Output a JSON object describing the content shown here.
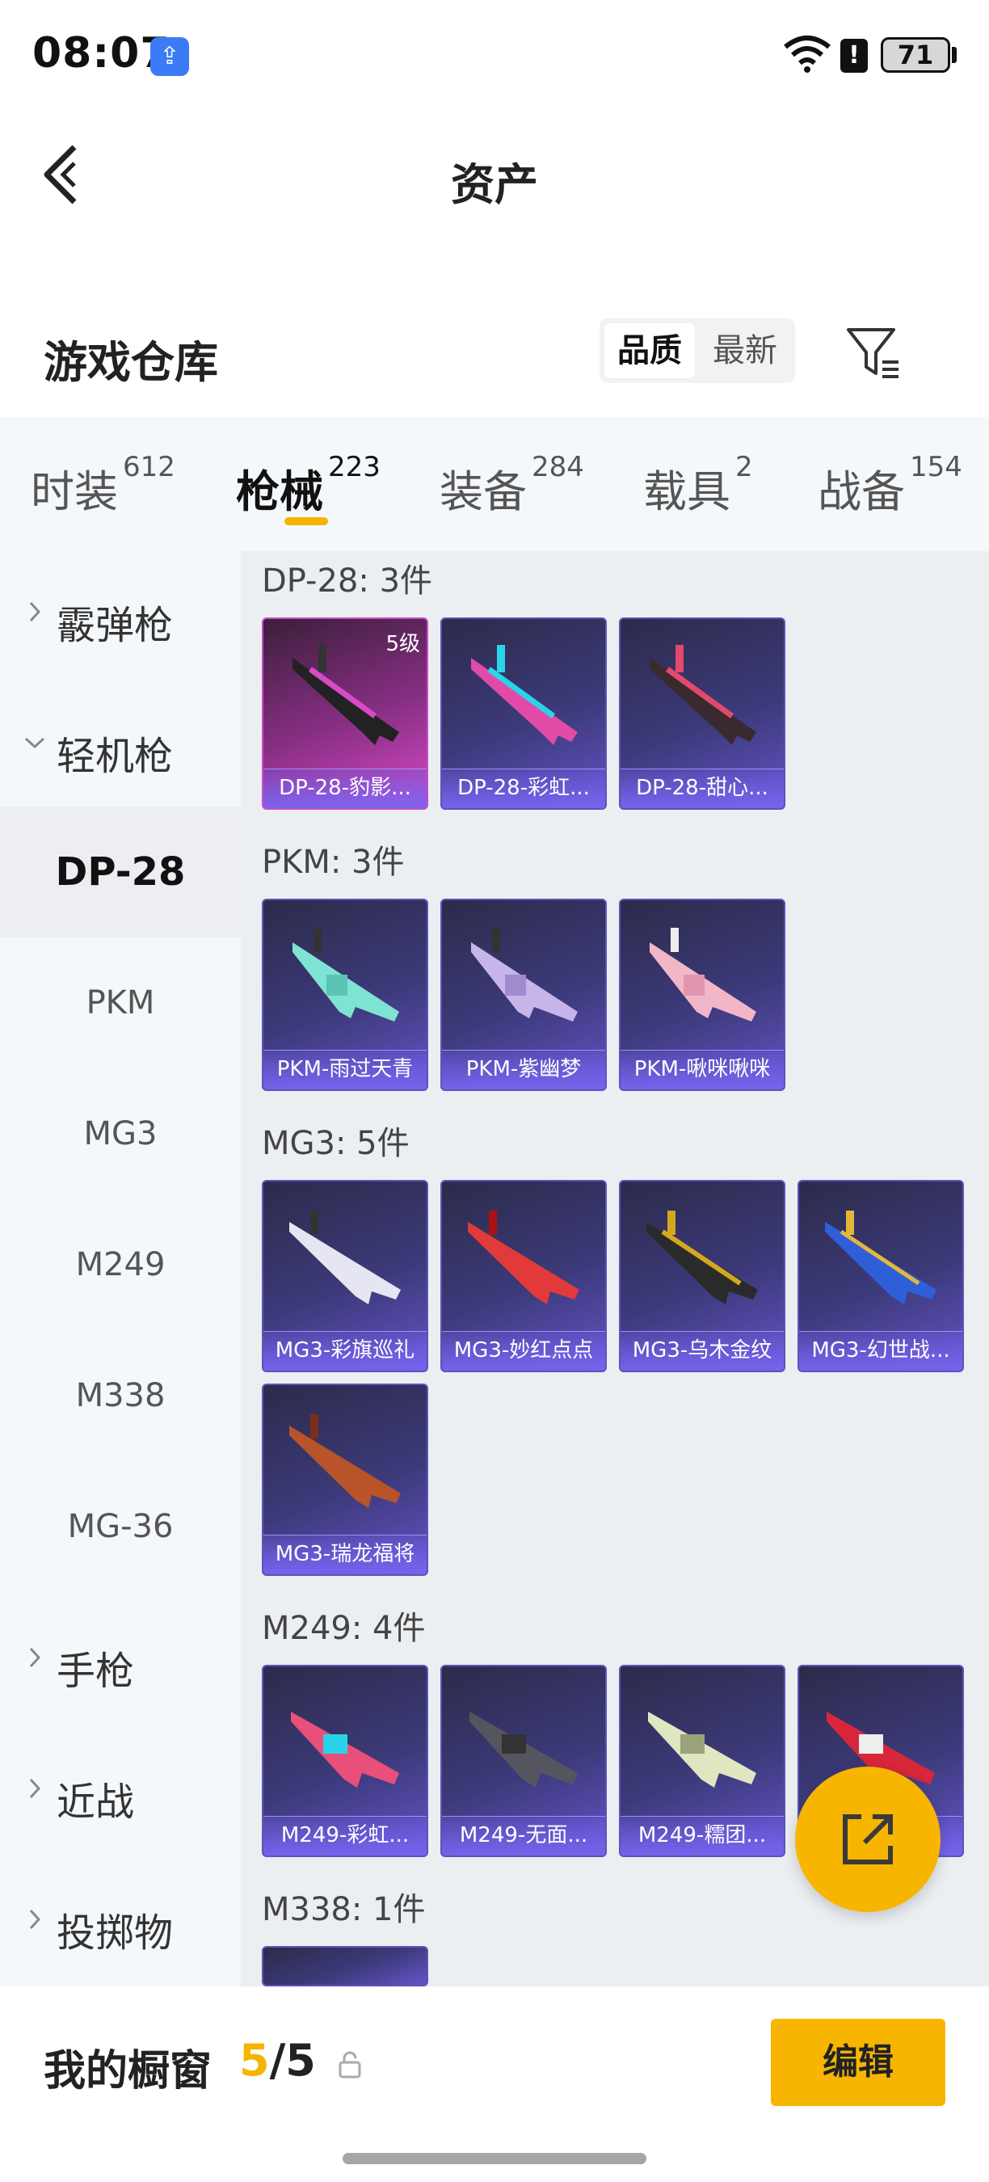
{
  "status_bar": {
    "time": "08:07",
    "battery": "71"
  },
  "nav": {
    "title": "资产"
  },
  "repo": {
    "title": "游戏仓库",
    "sort_options": [
      "品质",
      "最新"
    ],
    "sort_active": "品质"
  },
  "tabs": [
    {
      "label": "时装",
      "count": "612"
    },
    {
      "label": "枪械",
      "count": "223"
    },
    {
      "label": "装备",
      "count": "284"
    },
    {
      "label": "载具",
      "count": "2"
    },
    {
      "label": "战备",
      "count": "154"
    }
  ],
  "sidebar": {
    "items": [
      {
        "label": "霰弹枪",
        "type": "group"
      },
      {
        "label": "轻机枪",
        "type": "group"
      },
      {
        "label": "DP-28",
        "type": "sub"
      },
      {
        "label": "PKM",
        "type": "sub"
      },
      {
        "label": "MG3",
        "type": "sub"
      },
      {
        "label": "M249",
        "type": "sub"
      },
      {
        "label": "M338",
        "type": "sub"
      },
      {
        "label": "MG-36",
        "type": "sub"
      },
      {
        "label": "手枪",
        "type": "group"
      },
      {
        "label": "近战",
        "type": "group"
      },
      {
        "label": "投掷物",
        "type": "group"
      }
    ]
  },
  "groups": [
    {
      "title": "DP-28: 3件",
      "items": [
        {
          "name": "DP-28-豹影...",
          "level": "5级",
          "accent": "#d94ac6"
        },
        {
          "name": "DP-28-彩虹...",
          "accent": "#2ad4e8"
        },
        {
          "name": "DP-28-甜心...",
          "accent": "#e24a6a"
        }
      ]
    },
    {
      "title": "PKM: 3件",
      "items": [
        {
          "name": "PKM-雨过天青",
          "accent": "#7fe3d3"
        },
        {
          "name": "PKM-紫幽梦",
          "accent": "#c7b5ea"
        },
        {
          "name": "PKM-啾咪啾咪",
          "accent": "#f2b6c9"
        }
      ]
    },
    {
      "title": "MG3: 5件",
      "items": [
        {
          "name": "MG3-彩旗巡礼",
          "accent": "#e6e6f2"
        },
        {
          "name": "MG3-妙红点点",
          "accent": "#e23a3a"
        },
        {
          "name": "MG3-乌木金纹",
          "accent": "#d4a81e"
        },
        {
          "name": "MG3-幻世战...",
          "accent": "#2f5fd8"
        },
        {
          "name": "MG3-瑞龙福将",
          "accent": "#b8532a"
        }
      ]
    },
    {
      "title": "M249: 4件",
      "items": [
        {
          "name": "M249-彩虹...",
          "accent": "#e8507a"
        },
        {
          "name": "M249-无面...",
          "accent": "#555560"
        },
        {
          "name": "M249-糯团...",
          "accent": "#dfe6c0"
        },
        {
          "name": "...",
          "accent": "#d8263a"
        }
      ]
    },
    {
      "title": "M338: 1件",
      "items": []
    }
  ],
  "bottom": {
    "label": "我的橱窗",
    "current": "5",
    "total": "/5",
    "edit_label": "编辑"
  },
  "colors": {
    "accent": "#f8b500",
    "card_bg": "#3c3a7a"
  }
}
